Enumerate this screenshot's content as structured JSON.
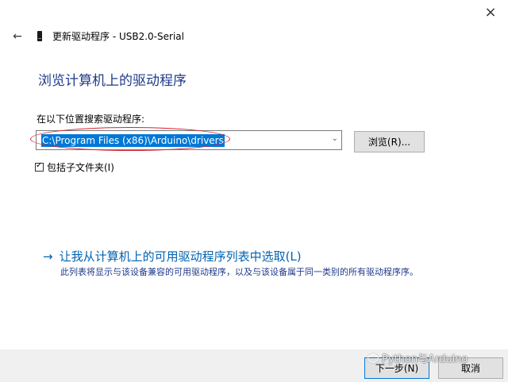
{
  "window": {
    "close_icon": "×",
    "back_icon": "←",
    "title": "更新驱动程序 - USB2.0-Serial"
  },
  "main": {
    "heading": "浏览计算机上的驱动程序",
    "search_label": "在以下位置搜索驱动程序:",
    "path_value": "C:\\Program Files (x86)\\Arduino\\drivers",
    "combo_arrow": "⌄",
    "browse_label": "浏览(R)...",
    "include_subfolders_label": "包括子文件夹(I)",
    "include_subfolders_checked": true,
    "pick_arrow": "→",
    "pick_link": "让我从计算机上的可用驱动程序列表中选取(L)",
    "pick_desc": "此列表将显示与该设备兼容的可用驱动程序，以及与该设备属于同一类别的所有驱动程序序。"
  },
  "footer": {
    "next_label": "下一步(N)",
    "cancel_label": "取消"
  },
  "watermark": {
    "text": "Python与Arduino"
  },
  "colors": {
    "heading": "#1e3a8a",
    "link": "#0063b1",
    "selection": "#0078d7",
    "annotation": "#d9232e"
  }
}
